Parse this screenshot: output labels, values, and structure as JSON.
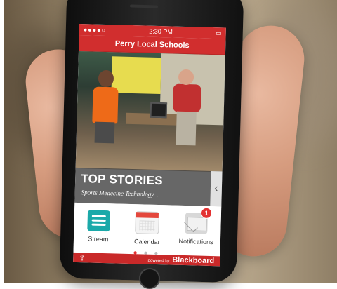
{
  "status_bar": {
    "signal": "●●●●○",
    "time": "2:30 PM",
    "battery": "▭"
  },
  "app_bar": {
    "title": "Perry Local Schools"
  },
  "top_stories": {
    "title": "TOP STORIES",
    "subtitle": "Sports Medecine Technology..."
  },
  "icons": [
    {
      "label": "Stream",
      "icon": "stream-icon"
    },
    {
      "label": "Calendar",
      "icon": "calendar-icon"
    },
    {
      "label": "Notifications",
      "icon": "notifications-icon",
      "badge": "1"
    }
  ],
  "pager": {
    "dots": [
      "●",
      "●",
      "●"
    ],
    "active_index": 0
  },
  "footer": {
    "powered_by": "powered by",
    "brand": "Blackboard"
  },
  "colors": {
    "app_red": "#d12e2e",
    "stream_teal": "#1ba9a9",
    "badge_red": "#e33131"
  }
}
